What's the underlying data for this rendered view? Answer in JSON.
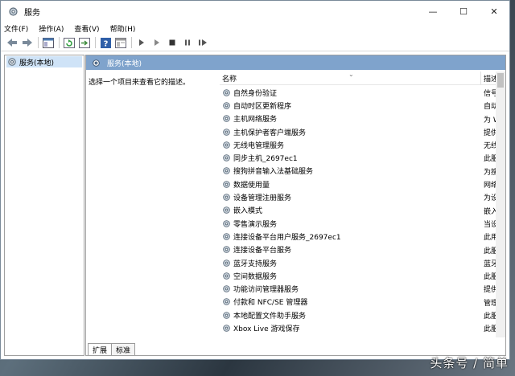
{
  "window": {
    "title": "服务",
    "controls": {
      "minimize": "—",
      "maximize": "☐",
      "close": "✕"
    }
  },
  "menu": [
    "文件(F)",
    "操作(A)",
    "查看(V)",
    "帮助(H)"
  ],
  "tree": {
    "root": "服务(本地)"
  },
  "pane": {
    "header": "服务(本地)",
    "description": "选择一个项目来查看它的描述。"
  },
  "list": {
    "columns": {
      "name": "名称",
      "desc": "描述"
    },
    "rows": [
      {
        "name": "自然身份验证",
        "desc": "信号"
      },
      {
        "name": "自动时区更新程序",
        "desc": "自动"
      },
      {
        "name": "主机网络服务",
        "desc": "为 W"
      },
      {
        "name": "主机保护者客户端服务",
        "desc": "提供"
      },
      {
        "name": "无线电管理服务",
        "desc": "无线"
      },
      {
        "name": "同步主机_2697ec1",
        "desc": "此服"
      },
      {
        "name": "搜狗拼音输入法基础服务",
        "desc": "为搜"
      },
      {
        "name": "数据使用量",
        "desc": "网络"
      },
      {
        "name": "设备管理注册服务",
        "desc": "为设"
      },
      {
        "name": "嵌入模式",
        "desc": "嵌入"
      },
      {
        "name": "零售演示服务",
        "desc": "当设"
      },
      {
        "name": "连接设备平台用户服务_2697ec1",
        "desc": "此用"
      },
      {
        "name": "连接设备平台服务",
        "desc": "此服"
      },
      {
        "name": "蓝牙支持服务",
        "desc": "蓝牙"
      },
      {
        "name": "空间数据服务",
        "desc": "此服"
      },
      {
        "name": "功能访问管理器服务",
        "desc": "提供"
      },
      {
        "name": "付款和 NFC/SE 管理器",
        "desc": "管理"
      },
      {
        "name": "本地配置文件助手服务",
        "desc": "此服"
      },
      {
        "name": "Xbox Live 游戏保存",
        "desc": "此服"
      }
    ]
  },
  "tabs": [
    "扩展",
    "标准"
  ],
  "watermark": "头条号 / 简单"
}
